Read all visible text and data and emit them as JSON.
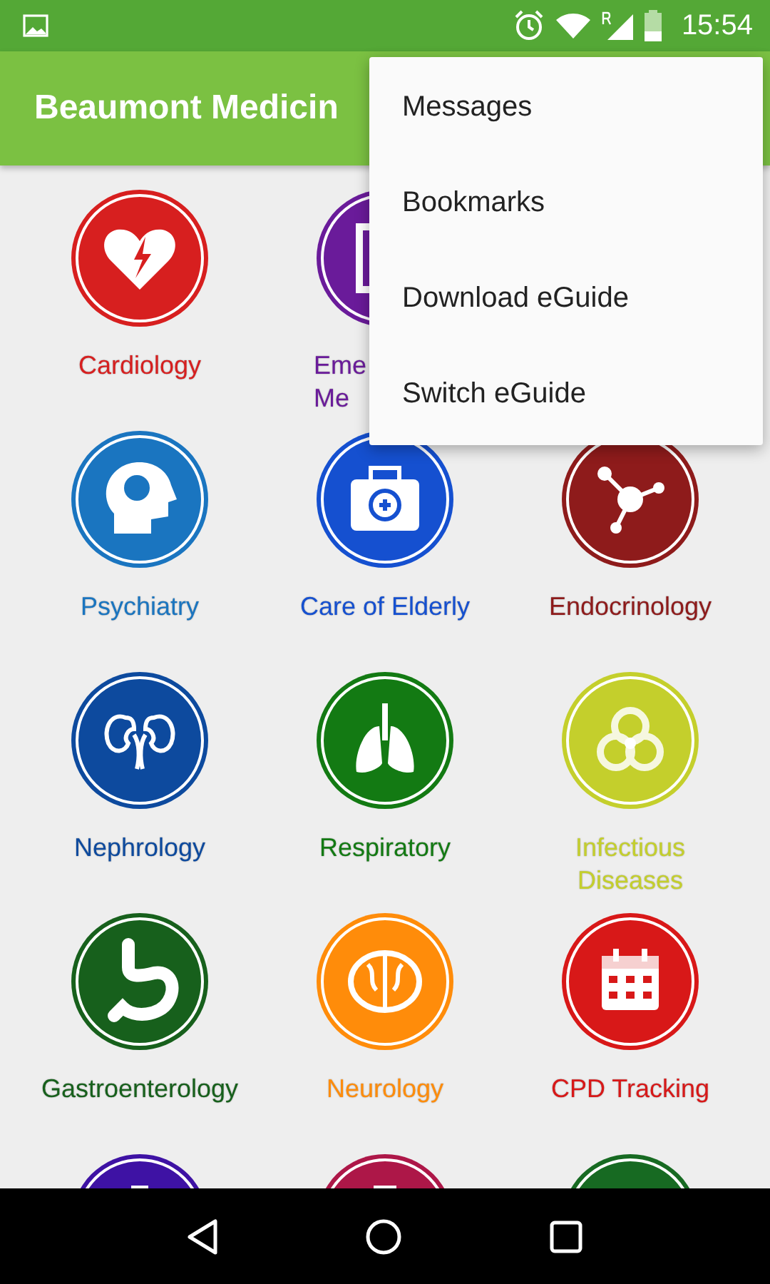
{
  "status_bar": {
    "time": "15:54"
  },
  "app_bar": {
    "title": "Beaumont Medicin"
  },
  "menu": {
    "items": [
      {
        "label": "Messages"
      },
      {
        "label": "Bookmarks"
      },
      {
        "label": "Download eGuide"
      },
      {
        "label": "Switch eGuide"
      }
    ]
  },
  "rows": [
    [
      {
        "lines": [
          "Cardiology"
        ],
        "color": "#d71f1f"
      },
      {
        "lines": [
          "Eme",
          "Me"
        ],
        "color": "#6a1b9a",
        "covered": true
      }
    ],
    [
      {
        "lines": [
          "Psychiatry"
        ],
        "color": "#1a75c0"
      },
      {
        "lines": [
          "Care of Elderly"
        ],
        "color": "#1550d0"
      },
      {
        "lines": [
          "Endocrinology"
        ],
        "color": "#8e1b1b"
      }
    ],
    [
      {
        "lines": [
          "Nephrology"
        ],
        "color": "#0d4a9e"
      },
      {
        "lines": [
          "Respiratory"
        ],
        "color": "#137a13"
      },
      {
        "lines": [
          "Infectious",
          "Diseases"
        ],
        "color": "#c4cf2c"
      }
    ],
    [
      {
        "lines": [
          "Gastroenterology"
        ],
        "color": "#17601c"
      },
      {
        "lines": [
          "Neurology"
        ],
        "color": "#ff8c0a"
      },
      {
        "lines": [
          "CPD Tracking"
        ],
        "color": "#d81818"
      }
    ],
    [
      {
        "color": "#3e12a4"
      },
      {
        "color": "#ad1748"
      },
      {
        "color": "#176a22"
      }
    ]
  ]
}
